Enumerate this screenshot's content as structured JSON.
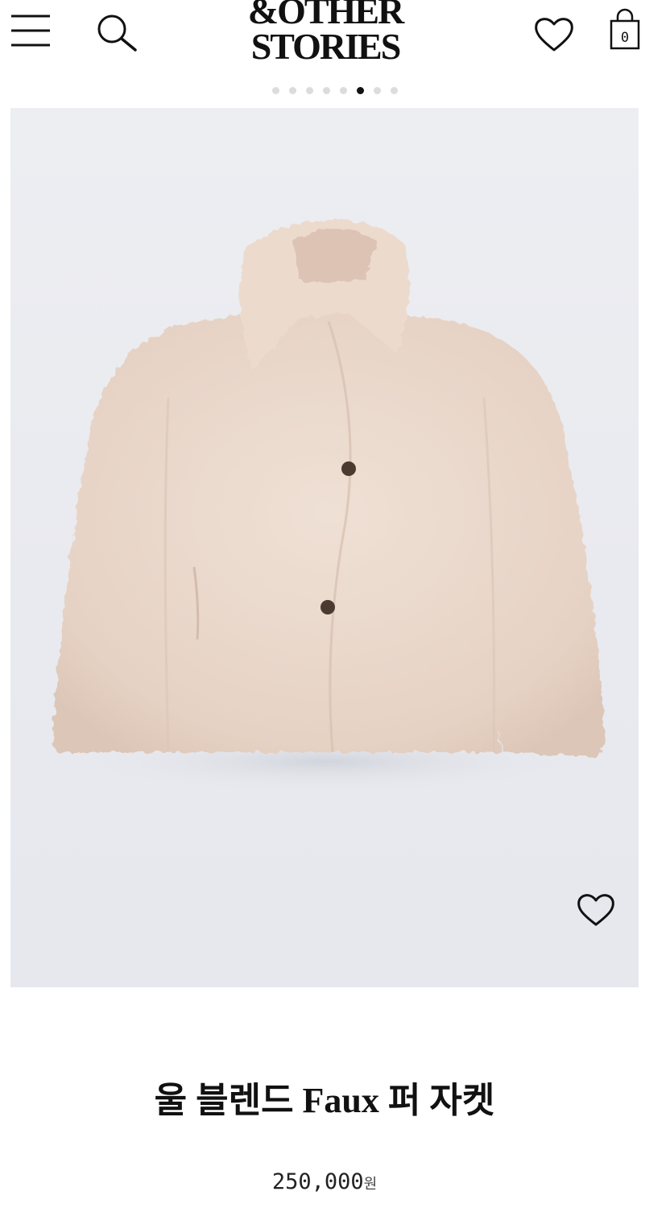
{
  "header": {
    "logo_line1": "&OTHER",
    "logo_line2": "STORIES",
    "bag_count": "0",
    "icons": [
      "menu-icon",
      "search-icon",
      "heart-icon",
      "shopping-bag-icon"
    ]
  },
  "carousel": {
    "total_slides": 8,
    "active_slide": 6
  },
  "product": {
    "name": "울 블렌드 Faux 퍼 자켓",
    "price_value": "250,000",
    "price_unit": "원",
    "image_alt_icon": "heart-icon"
  },
  "colors": {
    "jacket": "#ead8cc",
    "image_background": "#eaebf0",
    "active_dot": "#111111",
    "inactive_dot": "#dcdcdc"
  }
}
